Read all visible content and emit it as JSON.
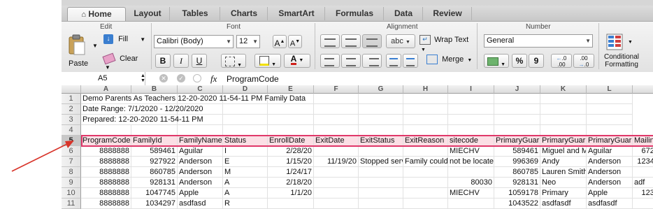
{
  "ribbon": {
    "tabs": [
      "Home",
      "Layout",
      "Tables",
      "Charts",
      "SmartArt",
      "Formulas",
      "Data",
      "Review"
    ],
    "active_tab": "Home",
    "groups": {
      "edit": "Edit",
      "font": "Font",
      "alignment": "Alignment",
      "number": "Number"
    },
    "paste_label": "Paste",
    "fill_label": "Fill",
    "clear_label": "Clear",
    "font_name": "Calibri (Body)",
    "font_size": "12",
    "bold": "B",
    "italic": "I",
    "underline": "U",
    "wrap_text": "Wrap Text",
    "merge": "Merge",
    "abc": "abc",
    "number_format": "General",
    "percent": "%",
    "comma": "9",
    "conditional_formatting": "Conditional Formatting",
    "inc_decimal": ".00",
    "dec_decimal": ".0"
  },
  "formula_bar": {
    "name_box": "A5",
    "fx": "fx",
    "content": "ProgramCode"
  },
  "columns": [
    "A",
    "B",
    "C",
    "D",
    "E",
    "F",
    "G",
    "H",
    "I",
    "J",
    "K",
    "L"
  ],
  "rows": [
    {
      "num": "1",
      "cells": [
        "Demo Parents As Teachers 12-20-2020 11-54-11 PM Family Data",
        "",
        "",
        "",
        "",
        "",
        "",
        "",
        "",
        "",
        "",
        ""
      ]
    },
    {
      "num": "2",
      "cells": [
        "Date Range: 7/1/2020 - 12/20/2020",
        "",
        "",
        "",
        "",
        "",
        "",
        "",
        "",
        "",
        "",
        ""
      ]
    },
    {
      "num": "3",
      "cells": [
        "Prepared: 12-20-2020 11-54-11 PM",
        "",
        "",
        "",
        "",
        "",
        "",
        "",
        "",
        "",
        "",
        ""
      ]
    },
    {
      "num": "4",
      "cells": [
        "",
        "",
        "",
        "",
        "",
        "",
        "",
        "",
        "",
        "",
        "",
        ""
      ]
    },
    {
      "num": "5",
      "cells": [
        "ProgramCode",
        "FamilyId",
        "FamilyName",
        "Status",
        "EnrollDate",
        "ExitDate",
        "ExitStatus",
        "ExitReason",
        "sitecode",
        "PrimaryGuar",
        "PrimaryGuar",
        "PrimaryGuar",
        "Mailin"
      ]
    },
    {
      "num": "6",
      "cells": [
        "8888888",
        "589461",
        "Aguilar",
        "I",
        "2/28/20",
        "",
        "",
        "",
        "MIECHV",
        "589461",
        "Miguel and M",
        "Aguilar",
        "6722"
      ]
    },
    {
      "num": "7",
      "cells": [
        "8888888",
        "927922",
        "Anderson",
        "E",
        "1/15/20",
        "11/19/20",
        "Stopped serv",
        "Family could",
        "not be locate",
        "996369",
        "Andy",
        "Anderson",
        "12345"
      ]
    },
    {
      "num": "8",
      "cells": [
        "8888888",
        "860785",
        "Anderson",
        "M",
        "1/24/17",
        "",
        "",
        "",
        "",
        "860785",
        "Lauren Smith",
        "Anderson",
        ""
      ]
    },
    {
      "num": "9",
      "cells": [
        "8888888",
        "928131",
        "Anderson",
        "A",
        "2/18/20",
        "",
        "",
        "",
        "80030",
        "928131",
        "Neo",
        "Anderson",
        "adf"
      ]
    },
    {
      "num": "10",
      "cells": [
        "8888888",
        "1047745",
        "Apple",
        "A",
        "1/1/20",
        "",
        "",
        "",
        "MIECHV",
        "1059178",
        "Primary",
        "Apple",
        "1234"
      ]
    },
    {
      "num": "11",
      "cells": [
        "8888888",
        "1034297",
        "asdfasd",
        "R",
        "",
        "",
        "",
        "",
        "",
        "1043522",
        "asdfasdf",
        "asdfasdf",
        ""
      ]
    }
  ]
}
